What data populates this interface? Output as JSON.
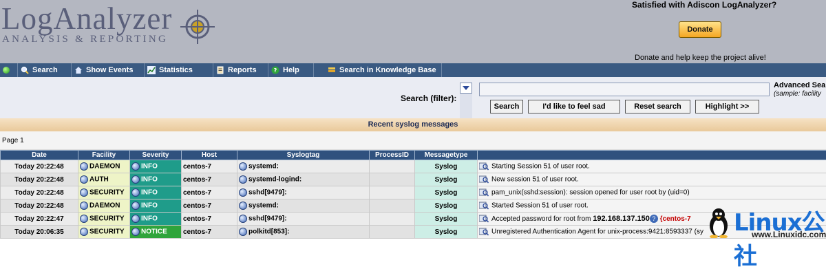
{
  "header": {
    "logo_title": "LogAnalyzer",
    "logo_subtitle": "ANALYSIS & REPORTING",
    "promo_title": "Satisfied with Adiscon LogAnalyzer?",
    "donate_label": "Donate",
    "promo_note": "Donate and help keep the project alive!"
  },
  "nav": {
    "items": [
      {
        "label": "Search",
        "icon": "magnifier-icon"
      },
      {
        "label": "Show Events",
        "icon": "home-icon"
      },
      {
        "label": "Statistics",
        "icon": "chart-icon"
      },
      {
        "label": "Reports",
        "icon": "report-icon"
      },
      {
        "label": "Help",
        "icon": "help-icon"
      },
      {
        "label": "Search in Knowledge Base",
        "icon": "books-icon"
      }
    ]
  },
  "search": {
    "filter_label": "Search (filter):",
    "input_value": "",
    "buttons": [
      "Search",
      "I'd like to feel sad",
      "Reset search",
      "Highlight >>"
    ],
    "advanced_label": "Advanced Sea",
    "advanced_sample": "(sample: facility"
  },
  "section_title": "Recent syslog messages",
  "page_label": "Page 1",
  "table": {
    "headers": [
      "Date",
      "Facility",
      "Severity",
      "Host",
      "Syslogtag",
      "ProcessID",
      "Messagetype",
      ""
    ],
    "rows": [
      {
        "date": "Today 20:22:48",
        "facility": "DAEMON",
        "severity": "INFO",
        "host": "centos-7",
        "tag": "systemd:",
        "pid": "",
        "type": "Syslog",
        "msg": "Starting Session 51 of user root."
      },
      {
        "date": "Today 20:22:48",
        "facility": "AUTH",
        "severity": "INFO",
        "host": "centos-7",
        "tag": "systemd-logind:",
        "pid": "",
        "type": "Syslog",
        "msg": "New session 51 of user root."
      },
      {
        "date": "Today 20:22:48",
        "facility": "SECURITY",
        "severity": "INFO",
        "host": "centos-7",
        "tag": "sshd[9479]:",
        "pid": "",
        "type": "Syslog",
        "msg": "pam_unix(sshd:session): session opened for user root by (uid=0)"
      },
      {
        "date": "Today 20:22:48",
        "facility": "DAEMON",
        "severity": "INFO",
        "host": "centos-7",
        "tag": "systemd:",
        "pid": "",
        "type": "Syslog",
        "msg": "Started Session 51 of user root."
      },
      {
        "date": "Today 20:22:47",
        "facility": "SECURITY",
        "severity": "INFO",
        "host": "centos-7",
        "tag": "sshd[9479]:",
        "pid": "",
        "type": "Syslog",
        "msg": "Accepted password for root from",
        "ip": "192.168.137.150",
        "extra": "{centos-7"
      },
      {
        "date": "Today 20:06:35",
        "facility": "SECURITY",
        "severity": "NOTICE",
        "host": "centos-7",
        "tag": "polkitd[853]:",
        "pid": "",
        "type": "Syslog",
        "msg": "Unregistered Authentication Agent for unix-process:9421:8593337 (sy"
      }
    ]
  },
  "watermark": {
    "big": "Linux公社",
    "small": "www.Linuxidc.com"
  }
}
